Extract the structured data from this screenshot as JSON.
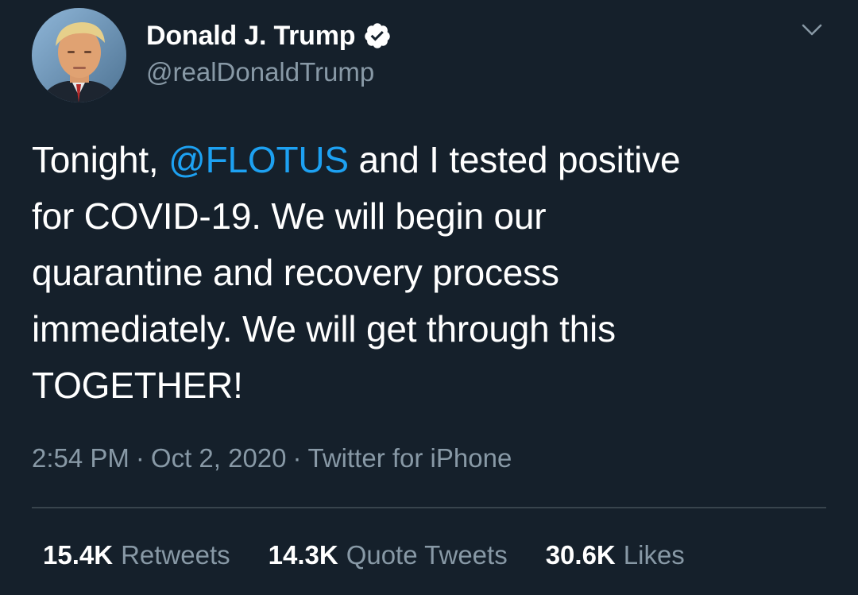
{
  "tweet": {
    "author": {
      "display_name": "Donald J. Trump",
      "handle": "@realDonaldTrump",
      "verified_icon": "verified-badge-icon"
    },
    "text_lines": [
      {
        "before": "Tonight, ",
        "mention": "@FLOTUS",
        "after": " and I tested positive"
      },
      "for COVID-19. We will begin our",
      "quarantine and recovery process",
      "immediately. We will get through this",
      "TOGETHER!"
    ],
    "time": "2:54 PM",
    "date": "Oct 2, 2020",
    "source": "Twitter for iPhone",
    "separator": "·",
    "stats": {
      "retweets": {
        "count": "15.4K",
        "label": "Retweets"
      },
      "quote_tweets": {
        "count": "14.3K",
        "label": "Quote Tweets"
      },
      "likes": {
        "count": "30.6K",
        "label": "Likes"
      }
    }
  },
  "colors": {
    "background": "#15202b",
    "primary_text": "#ffffff",
    "secondary_text": "#8899a6",
    "mention": "#1da1f2",
    "divider": "#38444d"
  }
}
